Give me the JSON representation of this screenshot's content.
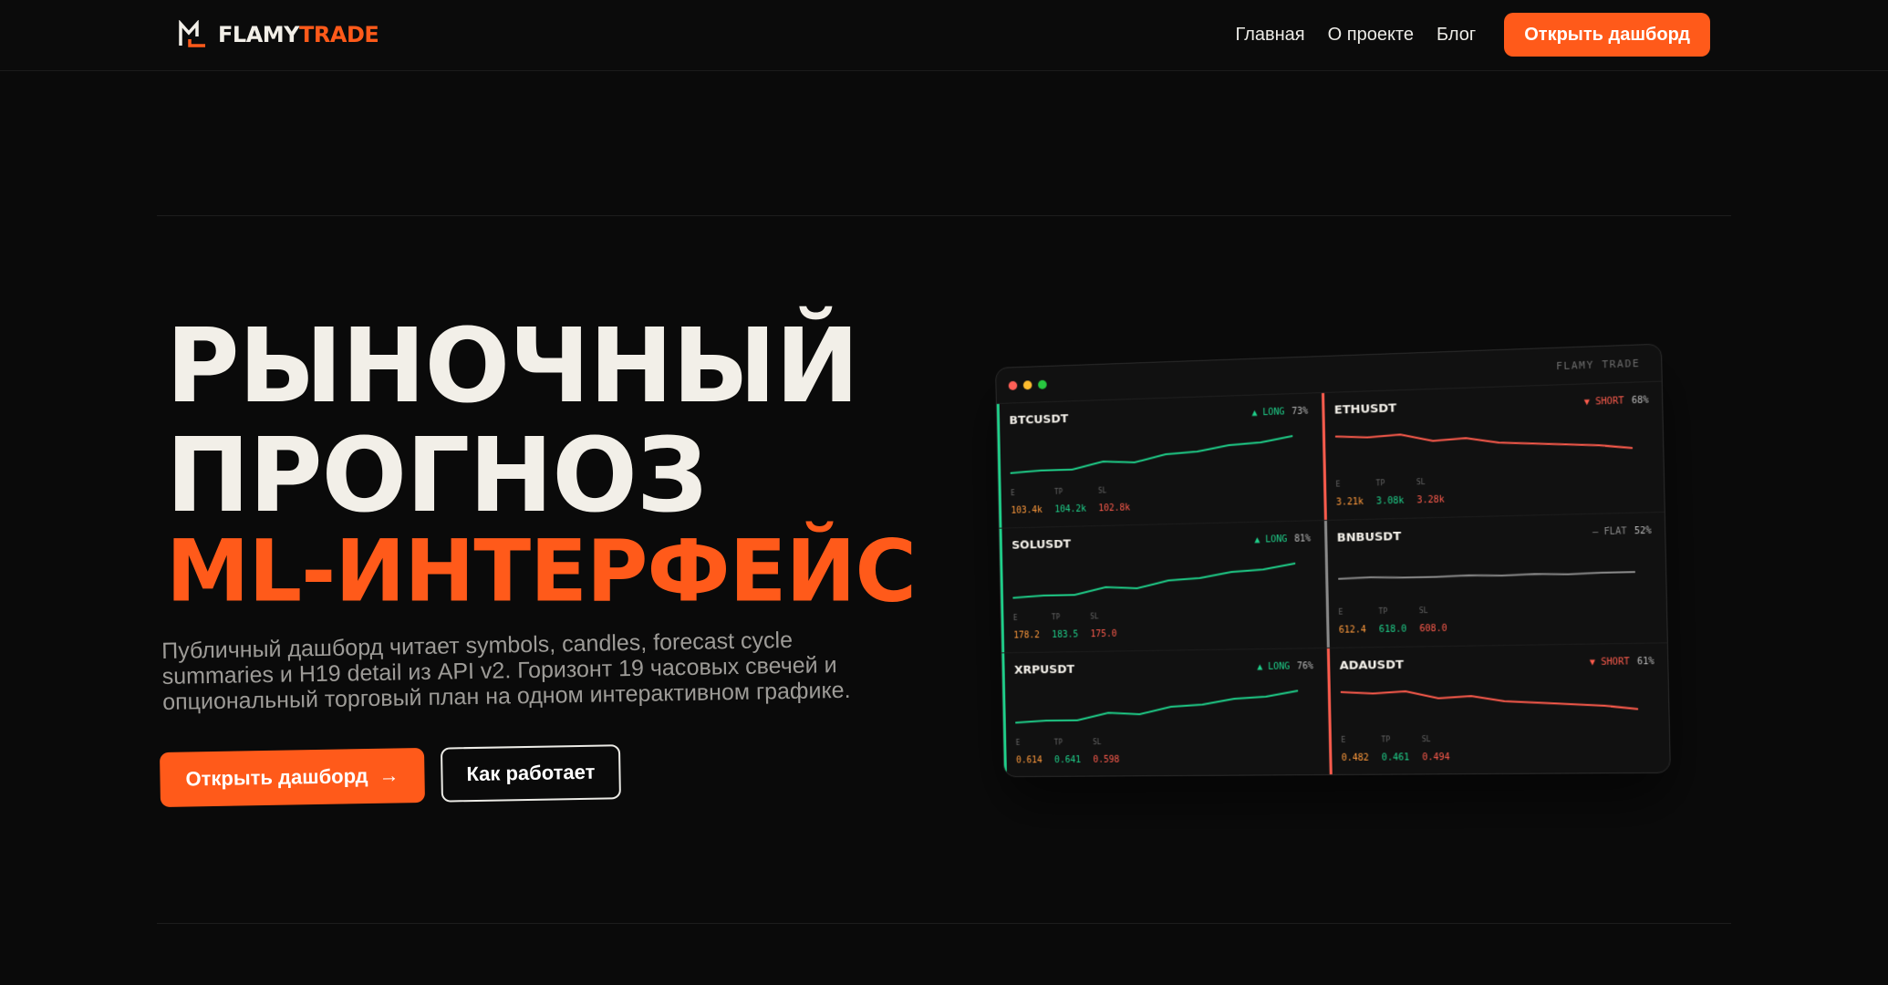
{
  "brand": {
    "word1": "FLAMY",
    "word2": "TRADE"
  },
  "nav": {
    "links": [
      "Главная",
      "О проекте",
      "Блог"
    ],
    "cta": "Открыть дашборд"
  },
  "hero": {
    "line1": "РЫНОЧНЫЙ",
    "line2": "ПРОГНОЗ",
    "line3": "ML-ИНТЕРФЕЙС",
    "lead": "Публичный дашборд читает symbols, candles, forecast cycle summaries и H19 detail из API v2. Горизонт 19 часовых свечей и опциональный торговый план на одном интерактивном графике.",
    "primary": "Открыть дашборд",
    "primary_arrow": "→",
    "secondary": "Как работает"
  },
  "mock": {
    "title": "FLAMY TRADE",
    "colors": {
      "long": "#1fd18b",
      "short": "#ff5c4d",
      "flat": "#8a8a8a",
      "entry": "#ff9a3c"
    },
    "level_labels": {
      "e": "E",
      "tp": "TP",
      "sl": "SL"
    },
    "cells": [
      {
        "symbol": "BTCUSDT",
        "dir": "LONG",
        "arrow": "▲",
        "conf": "73%",
        "e": "103.4k",
        "tp": "104.2k",
        "sl": "102.8k",
        "trend": "up"
      },
      {
        "symbol": "ETHUSDT",
        "dir": "SHORT",
        "arrow": "▼",
        "conf": "68%",
        "e": "3.21k",
        "tp": "3.08k",
        "sl": "3.28k",
        "trend": "down"
      },
      {
        "symbol": "SOLUSDT",
        "dir": "LONG",
        "arrow": "▲",
        "conf": "81%",
        "e": "178.2",
        "tp": "183.5",
        "sl": "175.0",
        "trend": "up"
      },
      {
        "symbol": "BNBUSDT",
        "dir": "FLAT",
        "arrow": "—",
        "conf": "52%",
        "e": "612.4",
        "tp": "618.0",
        "sl": "608.0",
        "trend": "flat"
      },
      {
        "symbol": "XRPUSDT",
        "dir": "LONG",
        "arrow": "▲",
        "conf": "76%",
        "e": "0.614",
        "tp": "0.641",
        "sl": "0.598",
        "trend": "up"
      },
      {
        "symbol": "ADAUSDT",
        "dir": "SHORT",
        "arrow": "▼",
        "conf": "61%",
        "e": "0.482",
        "tp": "0.461",
        "sl": "0.494",
        "trend": "down"
      }
    ]
  }
}
